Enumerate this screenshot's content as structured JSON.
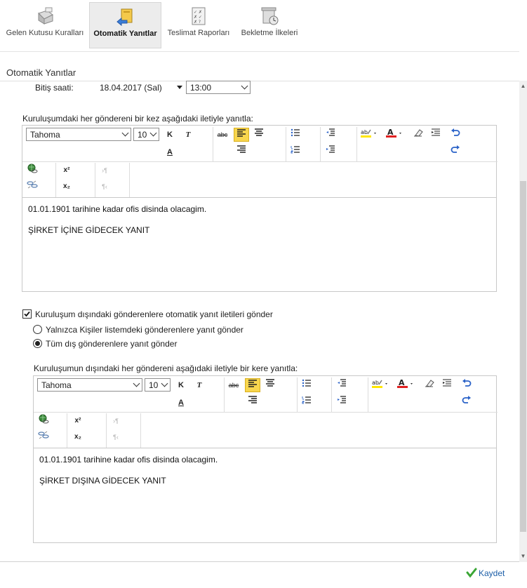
{
  "toolbar": {
    "items": [
      {
        "label": "Gelen Kutusu Kuralları",
        "icon": "inbox-rules-icon"
      },
      {
        "label": "Otomatik Yanıtlar",
        "icon": "auto-reply-icon",
        "active": true
      },
      {
        "label": "Teslimat Raporları",
        "icon": "delivery-report-icon"
      },
      {
        "label": "Bekletme İlkeleri",
        "icon": "retention-policy-icon"
      }
    ]
  },
  "section_title": "Otomatik Yanıtlar",
  "end_time": {
    "label": "Bitiş saati:",
    "date": "18.04.2017 (Sal)",
    "time": "13:00"
  },
  "internal": {
    "label": "Kuruluşumdaki her göndereni bir kez aşağıdaki iletiyle yanıtla:",
    "font": "Tahoma",
    "size": "10",
    "lines": [
      "01.01.1901 tarihine kadar ofis disinda olacagim.",
      "ŞİRKET İÇİNE GİDECEK YANIT"
    ]
  },
  "external": {
    "checkbox_label": "Kuruluşum dışındaki gönderenlere otomatik yanıt iletileri gönder",
    "checked": true,
    "radio_contacts": "Yalnızca Kişiler listemdeki gönderenlere yanıt gönder",
    "radio_all": "Tüm dış gönderenlere yanıt gönder",
    "selected": "all",
    "label": "Kuruluşumun dışındaki her göndereni aşağıdaki iletiyle bir kere yanıtla:",
    "font": "Tahoma",
    "size": "10",
    "lines": [
      "01.01.1901  tarihine kadar ofis disinda olacagim.",
      "ŞİRKET DIŞINA GİDECEK YANIT"
    ]
  },
  "format_buttons": {
    "bold": "K",
    "italic": "T",
    "font_color": "A",
    "superscript": "x²",
    "subscript": "x₂",
    "strikethrough": "abc"
  },
  "colors": {
    "accent_selected": "#f8d64e",
    "font_color_bar": "#e02020",
    "highlight_bar": "#ffe600",
    "save_text": "#1d5fa8",
    "save_check": "#3aa635"
  },
  "save_label": "Kaydet"
}
